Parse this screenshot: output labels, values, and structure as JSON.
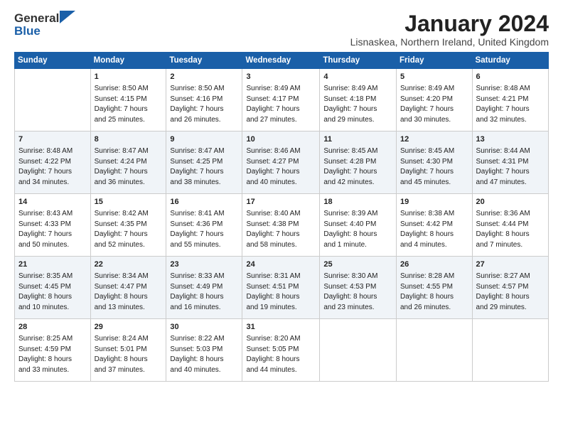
{
  "app": {
    "logo_general": "General",
    "logo_blue": "Blue",
    "title": "January 2024",
    "location": "Lisnaskea, Northern Ireland, United Kingdom"
  },
  "calendar": {
    "headers": [
      "Sunday",
      "Monday",
      "Tuesday",
      "Wednesday",
      "Thursday",
      "Friday",
      "Saturday"
    ],
    "weeks": [
      [
        {
          "day": "",
          "content": ""
        },
        {
          "day": "1",
          "content": "Sunrise: 8:50 AM\nSunset: 4:15 PM\nDaylight: 7 hours\nand 25 minutes."
        },
        {
          "day": "2",
          "content": "Sunrise: 8:50 AM\nSunset: 4:16 PM\nDaylight: 7 hours\nand 26 minutes."
        },
        {
          "day": "3",
          "content": "Sunrise: 8:49 AM\nSunset: 4:17 PM\nDaylight: 7 hours\nand 27 minutes."
        },
        {
          "day": "4",
          "content": "Sunrise: 8:49 AM\nSunset: 4:18 PM\nDaylight: 7 hours\nand 29 minutes."
        },
        {
          "day": "5",
          "content": "Sunrise: 8:49 AM\nSunset: 4:20 PM\nDaylight: 7 hours\nand 30 minutes."
        },
        {
          "day": "6",
          "content": "Sunrise: 8:48 AM\nSunset: 4:21 PM\nDaylight: 7 hours\nand 32 minutes."
        }
      ],
      [
        {
          "day": "7",
          "content": "Sunrise: 8:48 AM\nSunset: 4:22 PM\nDaylight: 7 hours\nand 34 minutes."
        },
        {
          "day": "8",
          "content": "Sunrise: 8:47 AM\nSunset: 4:24 PM\nDaylight: 7 hours\nand 36 minutes."
        },
        {
          "day": "9",
          "content": "Sunrise: 8:47 AM\nSunset: 4:25 PM\nDaylight: 7 hours\nand 38 minutes."
        },
        {
          "day": "10",
          "content": "Sunrise: 8:46 AM\nSunset: 4:27 PM\nDaylight: 7 hours\nand 40 minutes."
        },
        {
          "day": "11",
          "content": "Sunrise: 8:45 AM\nSunset: 4:28 PM\nDaylight: 7 hours\nand 42 minutes."
        },
        {
          "day": "12",
          "content": "Sunrise: 8:45 AM\nSunset: 4:30 PM\nDaylight: 7 hours\nand 45 minutes."
        },
        {
          "day": "13",
          "content": "Sunrise: 8:44 AM\nSunset: 4:31 PM\nDaylight: 7 hours\nand 47 minutes."
        }
      ],
      [
        {
          "day": "14",
          "content": "Sunrise: 8:43 AM\nSunset: 4:33 PM\nDaylight: 7 hours\nand 50 minutes."
        },
        {
          "day": "15",
          "content": "Sunrise: 8:42 AM\nSunset: 4:35 PM\nDaylight: 7 hours\nand 52 minutes."
        },
        {
          "day": "16",
          "content": "Sunrise: 8:41 AM\nSunset: 4:36 PM\nDaylight: 7 hours\nand 55 minutes."
        },
        {
          "day": "17",
          "content": "Sunrise: 8:40 AM\nSunset: 4:38 PM\nDaylight: 7 hours\nand 58 minutes."
        },
        {
          "day": "18",
          "content": "Sunrise: 8:39 AM\nSunset: 4:40 PM\nDaylight: 8 hours\nand 1 minute."
        },
        {
          "day": "19",
          "content": "Sunrise: 8:38 AM\nSunset: 4:42 PM\nDaylight: 8 hours\nand 4 minutes."
        },
        {
          "day": "20",
          "content": "Sunrise: 8:36 AM\nSunset: 4:44 PM\nDaylight: 8 hours\nand 7 minutes."
        }
      ],
      [
        {
          "day": "21",
          "content": "Sunrise: 8:35 AM\nSunset: 4:45 PM\nDaylight: 8 hours\nand 10 minutes."
        },
        {
          "day": "22",
          "content": "Sunrise: 8:34 AM\nSunset: 4:47 PM\nDaylight: 8 hours\nand 13 minutes."
        },
        {
          "day": "23",
          "content": "Sunrise: 8:33 AM\nSunset: 4:49 PM\nDaylight: 8 hours\nand 16 minutes."
        },
        {
          "day": "24",
          "content": "Sunrise: 8:31 AM\nSunset: 4:51 PM\nDaylight: 8 hours\nand 19 minutes."
        },
        {
          "day": "25",
          "content": "Sunrise: 8:30 AM\nSunset: 4:53 PM\nDaylight: 8 hours\nand 23 minutes."
        },
        {
          "day": "26",
          "content": "Sunrise: 8:28 AM\nSunset: 4:55 PM\nDaylight: 8 hours\nand 26 minutes."
        },
        {
          "day": "27",
          "content": "Sunrise: 8:27 AM\nSunset: 4:57 PM\nDaylight: 8 hours\nand 29 minutes."
        }
      ],
      [
        {
          "day": "28",
          "content": "Sunrise: 8:25 AM\nSunset: 4:59 PM\nDaylight: 8 hours\nand 33 minutes."
        },
        {
          "day": "29",
          "content": "Sunrise: 8:24 AM\nSunset: 5:01 PM\nDaylight: 8 hours\nand 37 minutes."
        },
        {
          "day": "30",
          "content": "Sunrise: 8:22 AM\nSunset: 5:03 PM\nDaylight: 8 hours\nand 40 minutes."
        },
        {
          "day": "31",
          "content": "Sunrise: 8:20 AM\nSunset: 5:05 PM\nDaylight: 8 hours\nand 44 minutes."
        },
        {
          "day": "",
          "content": ""
        },
        {
          "day": "",
          "content": ""
        },
        {
          "day": "",
          "content": ""
        }
      ]
    ]
  }
}
